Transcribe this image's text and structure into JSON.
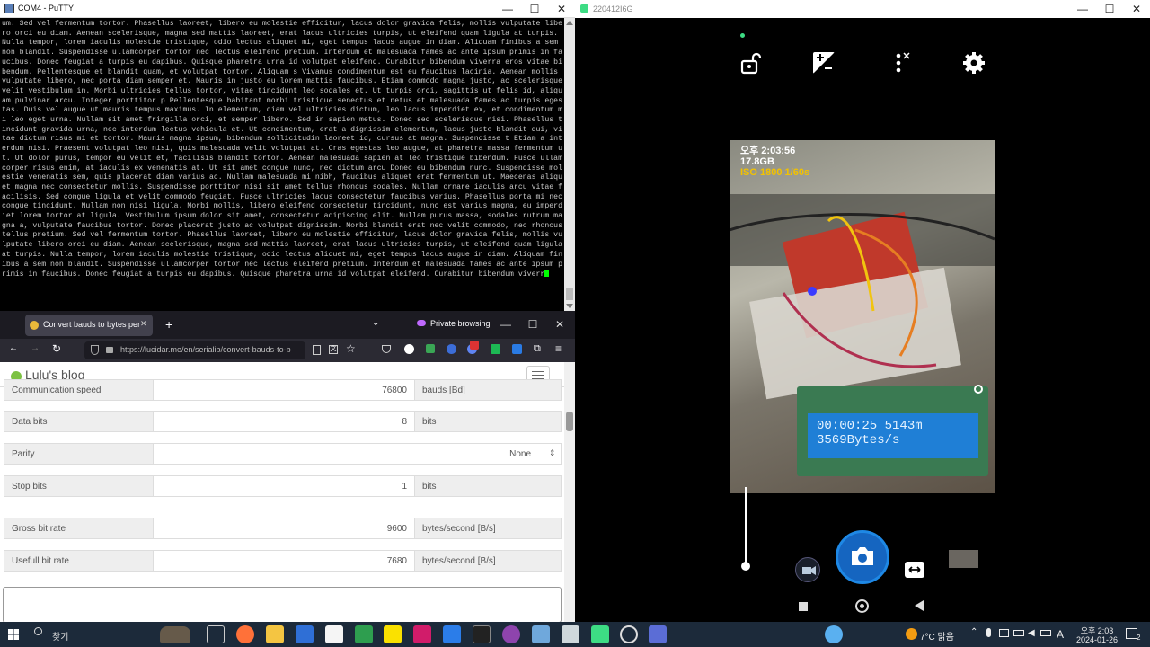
{
  "putty": {
    "title": "COM4 - PuTTY",
    "terminal_text": "um. Sed vel fermentum tortor. Phasellus laoreet, libero eu molestie efficitur, lacus dolor gravida felis, mollis vulputate libero orci eu diam. Aenean scelerisque, magna sed mattis laoreet, erat lacus ultricies turpis, ut eleifend quam ligula at turpis. Nulla tempor, lorem iaculis molestie tristique, odio lectus aliquet mi, eget tempus lacus augue in diam. Aliquam finibus a sem non blandit. Suspendisse ullamcorper tortor nec lectus eleifend pretium. Interdum et malesuada fames ac ante ipsum primis in faucibus. Donec feugiat a turpis eu dapibus. Quisque pharetra urna id volutpat eleifend. Curabitur bibendum viverra eros vitae bibendum. Pellentesque et blandit quam, et volutpat tortor. Aliquam s Vivamus condimentum est eu faucibus lacinia. Aenean mollis vulputate libero, nec porta diam semper et. Mauris in justo eu lorem mattis faucibus. Etiam commodo magna justo, ac scelerisque velit vestibulum in. Morbi ultricies tellus tortor, vitae tincidunt leo sodales et. Ut turpis orci, sagittis ut felis id, aliquam pulvinar arcu. Integer porttitor p Pellentesque habitant morbi tristique senectus et netus et malesuada fames ac turpis egestas. Duis vel augue ut mauris tempus maximus. In elementum, diam vel ultricies dictum, leo lacus imperdiet ex, et condimentum mi leo eget urna. Nullam sit amet fringilla orci, et semper libero. Sed in sapien metus. Donec sed scelerisque nisi. Phasellus tincidunt gravida urna, nec interdum lectus vehicula et. Ut condimentum, erat a dignissim elementum, lacus justo blandit dui, vitae dictum risus mi et tortor. Mauris magna ipsum, bibendum sollicitudin laoreet id, cursus at magna. Suspendisse t Etiam a interdum nisi. Praesent volutpat leo nisi, quis malesuada velit volutpat at. Cras egestas leo augue, at pharetra massa fermentum ut. Ut dolor purus, tempor eu velit et, facilisis blandit tortor. Aenean malesuada sapien at leo tristique bibendum. Fusce ullamcorper risus enim, at iaculis ex venenatis at. Ut sit amet congue nunc, nec dictum arcu Donec eu bibendum nunc. Suspendisse molestie venenatis sem, quis placerat diam varius ac. Nullam malesuada mi nibh, faucibus aliquet erat fermentum ut. Maecenas aliquet magna nec consectetur mollis. Suspendisse porttitor nisi sit amet tellus rhoncus sodales. Nullam ornare iaculis arcu vitae facilisis. Sed congue ligula et velit commodo feugiat. Fusce ultricies lacus consectetur faucibus varius. Phasellus porta mi nec congue tincidunt. Nullam non nisi ligula. Morbi mollis, libero eleifend consectetur tincidunt, nunc est varius magna, eu imperdiet lorem tortor at ligula. Vestibulum ipsum dolor sit amet, consectetur adipiscing elit. Nullam purus massa, sodales rutrum magna a, vulputate faucibus tortor. Donec placerat justo ac volutpat dignissim. Morbi blandit erat nec velit commodo, nec rhoncus tellus pretium. Sed vel fermentum tortor. Phasellus laoreet, libero eu molestie efficitur, lacus dolor gravida felis, mollis vulputate libero orci eu diam. Aenean scelerisque, magna sed mattis laoreet, erat lacus ultricies turpis, ut eleifend quam ligula at turpis. Nulla tempor, lorem iaculis molestie tristique, odio lectus aliquet mi, eget tempus lacus augue in diam. Aliquam finibus a sem non blandit. Suspendisse ullamcorper tortor nec lectus eleifend pretium. Interdum et malesuada fames ac ante ipsum primis in faucibus. Donec feugiat a turpis eu dapibus. Quisque pharetra urna id volutpat eleifend. Curabitur bibendum viverr"
  },
  "firefox": {
    "tab_title": "Convert bauds to bytes per se",
    "private_label": "Private browsing",
    "url": "https://lucidar.me/en/serialib/convert-bauds-to-b",
    "site_logo": "Lulu's blog",
    "rows": [
      {
        "label": "Communication speed",
        "value": "76800",
        "unit": "bauds [Bd]"
      },
      {
        "label": "Data bits",
        "value": "8",
        "unit": "bits"
      },
      {
        "label": "Parity",
        "value": "None",
        "unit": ""
      },
      {
        "label": "Stop bits",
        "value": "1",
        "unit": "bits"
      },
      {
        "label": "Gross bit rate",
        "value": "9600",
        "unit": "bytes/second [B/s]"
      },
      {
        "label": "Usefull bit rate",
        "value": "7680",
        "unit": "bytes/second [B/s]"
      }
    ]
  },
  "android": {
    "title": "220412I6G",
    "overlay_time": "오후 2:03:56",
    "overlay_storage": "17.8GB",
    "overlay_iso": "ISO 1800  1/60s",
    "lcd_line1": "00:00:25 5143m",
    "lcd_line2": "3569Bytes/s"
  },
  "taskbar": {
    "search_label": "찾기",
    "weather": "7°C  맑음",
    "ime": "A",
    "clock_time": "오후 2:03",
    "clock_date": "2024-01-26",
    "notif_count": "2"
  },
  "colors": {
    "accent_blue": "#1e88e5",
    "terminal_green": "#00ff00",
    "iso_yellow": "#f2c200",
    "taskbar": "#1c2a3a"
  }
}
